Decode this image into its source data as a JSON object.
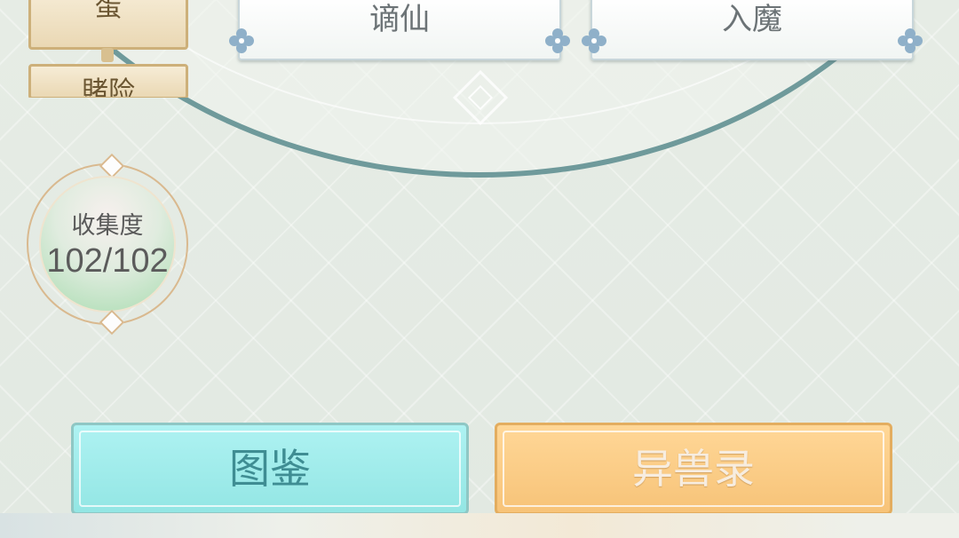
{
  "side_tabs": [
    "蛋",
    "賭险"
  ],
  "top_cards": [
    "谪仙",
    "入魔"
  ],
  "collection": {
    "title": "收集度",
    "count": "102/102"
  },
  "buttons": {
    "atlas": "图鉴",
    "beasts": "异兽录"
  },
  "colors": {
    "arc": "#6f9a9b",
    "atlas_bg": "#aef2f2",
    "beast_bg": "#ffd797",
    "tab_bg": "#f6ecd6"
  }
}
